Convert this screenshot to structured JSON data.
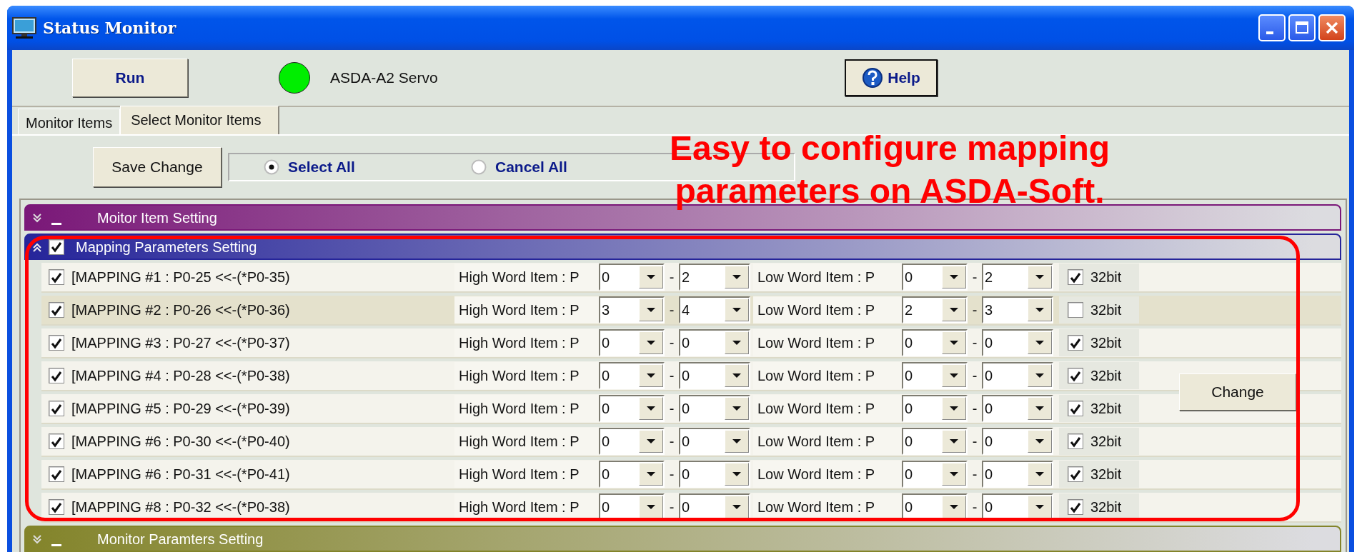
{
  "window": {
    "title": "Status Monitor"
  },
  "toolbar": {
    "run_button": "Run",
    "status_on": true,
    "device": "ASDA-A2 Servo",
    "help_button": "Help"
  },
  "tabs": [
    {
      "label": "Monitor Items",
      "selected": false
    },
    {
      "label": "Select Monitor Items",
      "selected": true
    }
  ],
  "save_button": "Save Change",
  "radios": [
    {
      "label": "Select All",
      "selected": true
    },
    {
      "label": "Cancel All",
      "selected": false
    }
  ],
  "annotation": "Easy to configure mapping parameters on ASDA-Soft.",
  "sections": [
    {
      "title": "Moitor Item Setting",
      "color": "#7a1878",
      "checked": false,
      "expanded": false
    },
    {
      "title": "Mapping Parameters Setting",
      "color": "#26259a",
      "checked": true,
      "expanded": true,
      "change_button": "Change",
      "rows": [
        {
          "label": "[MAPPING #1 : P0-25 <<-(*P0-35)",
          "checked": true,
          "selected": false,
          "high_label": "High Word Item : P",
          "high_from": "0",
          "high_dash": "-",
          "high_to": "2",
          "low_label": "Low Word Item : P",
          "low_from": "0",
          "low_dash": "-",
          "low_to": "2",
          "bit32": true,
          "bit_label": "32bit"
        },
        {
          "label": "[MAPPING #2 : P0-26 <<-(*P0-36)",
          "checked": true,
          "selected": true,
          "high_label": "High Word Item : P",
          "high_from": "3",
          "high_dash": "-",
          "high_to": "4",
          "low_label": "Low Word Item : P",
          "low_from": "2",
          "low_dash": "-",
          "low_to": "3",
          "bit32": false,
          "bit_label": "32bit"
        },
        {
          "label": "[MAPPING #3 : P0-27 <<-(*P0-37)",
          "checked": true,
          "selected": false,
          "high_label": "High Word Item : P",
          "high_from": "0",
          "high_dash": "-",
          "high_to": "0",
          "low_label": "Low Word Item : P",
          "low_from": "0",
          "low_dash": "-",
          "low_to": "0",
          "bit32": true,
          "bit_label": "32bit"
        },
        {
          "label": "[MAPPING #4 : P0-28 <<-(*P0-38)",
          "checked": true,
          "selected": false,
          "high_label": "High Word Item : P",
          "high_from": "0",
          "high_dash": "-",
          "high_to": "0",
          "low_label": "Low Word Item : P",
          "low_from": "0",
          "low_dash": "-",
          "low_to": "0",
          "bit32": true,
          "bit_label": "32bit"
        },
        {
          "label": "[MAPPING #5 : P0-29 <<-(*P0-39)",
          "checked": true,
          "selected": false,
          "high_label": "High Word Item : P",
          "high_from": "0",
          "high_dash": "-",
          "high_to": "0",
          "low_label": "Low Word Item : P",
          "low_from": "0",
          "low_dash": "-",
          "low_to": "0",
          "bit32": true,
          "bit_label": "32bit"
        },
        {
          "label": "[MAPPING #6 : P0-30 <<-(*P0-40)",
          "checked": true,
          "selected": false,
          "high_label": "High Word Item : P",
          "high_from": "0",
          "high_dash": "-",
          "high_to": "0",
          "low_label": "Low Word Item : P",
          "low_from": "0",
          "low_dash": "-",
          "low_to": "0",
          "bit32": true,
          "bit_label": "32bit"
        },
        {
          "label": "[MAPPING #6 : P0-31 <<-(*P0-41)",
          "checked": true,
          "selected": false,
          "high_label": "High Word Item : P",
          "high_from": "0",
          "high_dash": "-",
          "high_to": "0",
          "low_label": "Low Word Item : P",
          "low_from": "0",
          "low_dash": "-",
          "low_to": "0",
          "bit32": true,
          "bit_label": "32bit"
        },
        {
          "label": "[MAPPING #8 : P0-32 <<-(*P0-38)",
          "checked": true,
          "selected": false,
          "high_label": "High Word Item : P",
          "high_from": "0",
          "high_dash": "-",
          "high_to": "0",
          "low_label": "Low Word Item : P",
          "low_from": "0",
          "low_dash": "-",
          "low_to": "0",
          "bit32": true,
          "bit_label": "32bit"
        }
      ]
    },
    {
      "title": "Monitor Paramters Setting",
      "color": "#83842a",
      "checked": false,
      "expanded": false
    }
  ]
}
